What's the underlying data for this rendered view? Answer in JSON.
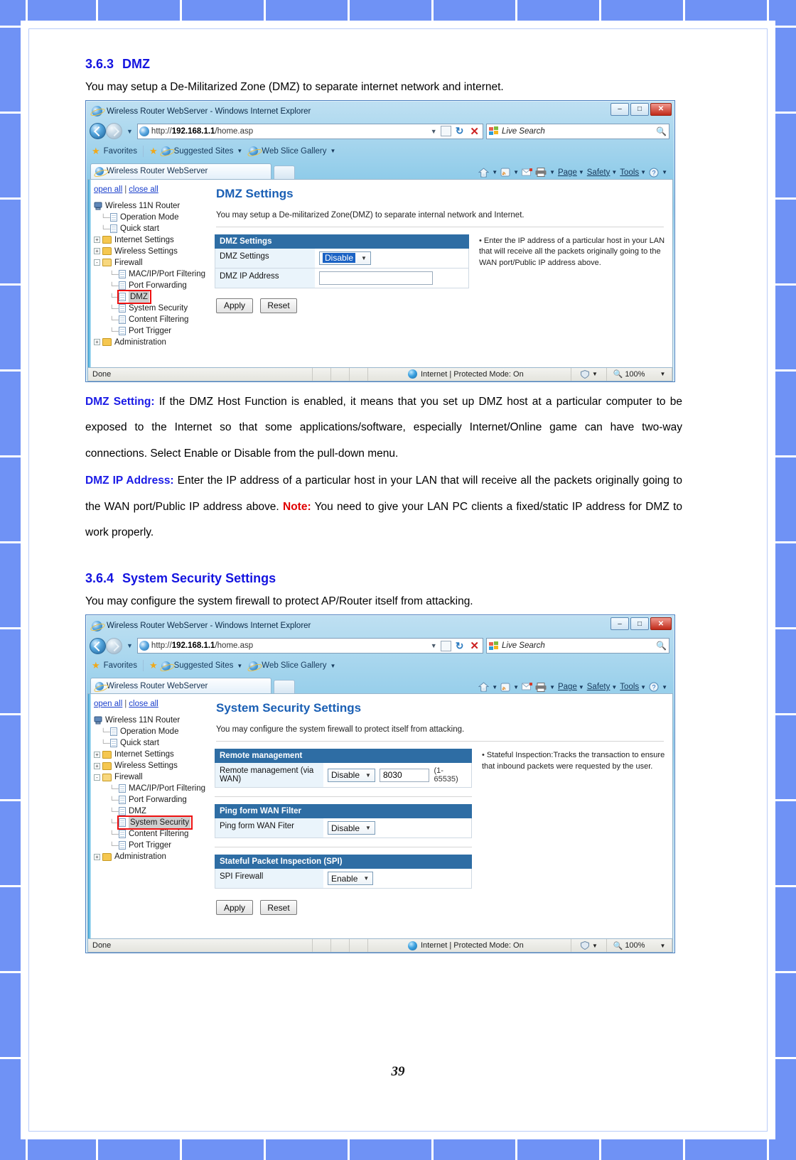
{
  "page": {
    "number": "39"
  },
  "sections": [
    {
      "id": "dmz",
      "number": "3.6.3",
      "title": "DMZ",
      "intro": "You may setup a De-Militarized Zone (DMZ) to separate internet network and internet."
    },
    {
      "id": "syssec",
      "number": "3.6.4",
      "title": "System Security Settings",
      "intro": "You may configure the system firewall to protect AP/Router itself from attacking."
    }
  ],
  "paragraphs": {
    "dmz_setting_label": "DMZ Setting:",
    "dmz_setting_text": " If the DMZ Host Function is enabled, it means that you set up DMZ host at a particular computer to be exposed to the Internet so that some applications/software, especially Internet/Online game can have two-way connections. Select Enable or Disable from the pull-down menu.",
    "dmz_ip_label": "DMZ IP Address:",
    "dmz_ip_text": " Enter the IP address of a particular host in your LAN that will receive all the packets originally going to the WAN port/Public IP address above.    ",
    "note_label": "Note:",
    "note_text": " You need to give your LAN PC clients a fixed/static IP address for DMZ to work properly."
  },
  "browser": {
    "window_title": "Wireless Router WebServer - Windows Internet Explorer",
    "minimize_label": "–",
    "maximize_label": "□",
    "close_label": "✕",
    "address_prefix": "http://",
    "address_host": "192.168.1.1",
    "address_path": "/home.asp",
    "search_placeholder": "Live Search",
    "favorites_label": "Favorites",
    "suggested_sites_label": "Suggested Sites",
    "web_slice_label": "Web Slice Gallery",
    "tab_label": "Wireless Router WebServer",
    "command_bar": [
      "Page",
      "Safety",
      "Tools"
    ],
    "status": {
      "done": "Done",
      "zone": "Internet | Protected Mode: On",
      "zoom": "100%"
    }
  },
  "tree": {
    "open_all": "open all",
    "close_all": "close all",
    "separator": "|",
    "root": "Wireless 11N Router",
    "items": [
      {
        "label": "Operation Mode",
        "type": "doc",
        "level": 1
      },
      {
        "label": "Quick start",
        "type": "doc",
        "level": 1
      },
      {
        "label": "Internet Settings",
        "type": "folder",
        "level": 1,
        "expander": "+"
      },
      {
        "label": "Wireless Settings",
        "type": "folder",
        "level": 1,
        "expander": "+"
      },
      {
        "label": "Firewall",
        "type": "folder-open",
        "level": 1,
        "expander": "-"
      },
      {
        "label": "MAC/IP/Port Filtering",
        "type": "doc",
        "level": 2
      },
      {
        "label": "Port Forwarding",
        "type": "doc",
        "level": 2
      },
      {
        "label": "DMZ",
        "type": "doc",
        "level": 2
      },
      {
        "label": "System Security",
        "type": "doc",
        "level": 2
      },
      {
        "label": "Content Filtering",
        "type": "doc",
        "level": 2
      },
      {
        "label": "Port Trigger",
        "type": "doc",
        "level": 2
      },
      {
        "label": "Administration",
        "type": "folder",
        "level": 1,
        "expander": "+"
      }
    ],
    "selected_dmz": "DMZ",
    "selected_syssec": "System Security"
  },
  "dmz_page": {
    "heading": "DMZ Settings",
    "description": "You may setup a De-militarized Zone(DMZ) to separate internal network and Internet.",
    "table_header": "DMZ Settings",
    "rows": [
      {
        "label": "DMZ Settings",
        "control": "select",
        "value": "Disable"
      },
      {
        "label": "DMZ IP Address",
        "control": "text",
        "value": ""
      }
    ],
    "note": "Enter the IP address of a particular host in your LAN that will receive all the packets originally going to the WAN port/Public IP address above.",
    "apply_label": "Apply",
    "reset_label": "Reset"
  },
  "syssec_page": {
    "heading": "System Security Settings",
    "description": "You may configure the system firewall to protect itself from attacking.",
    "panels": [
      {
        "header": "Remote management",
        "label": "Remote management (via WAN)",
        "select_value": "Disable",
        "port_value": "8030",
        "range_hint": "(1-65535)"
      },
      {
        "header": "Ping form WAN Filter",
        "label": "Ping form WAN Fiter",
        "select_value": "Disable"
      },
      {
        "header": "Stateful Packet Inspection (SPI)",
        "label": "SPI Firewall",
        "select_value": "Enable"
      }
    ],
    "note": "Stateful Inspection:Tracks the transaction to ensure that inbound packets were requested by the user.",
    "apply_label": "Apply",
    "reset_label": "Reset"
  },
  "colors": {
    "heading_blue": "#1414e0",
    "page_heading_blue": "#1a5fb4",
    "note_red": "#e00000",
    "table_header_blue": "#2e6da4",
    "border_blue": "#6f92f5",
    "highlight_red": "#ee1111"
  }
}
